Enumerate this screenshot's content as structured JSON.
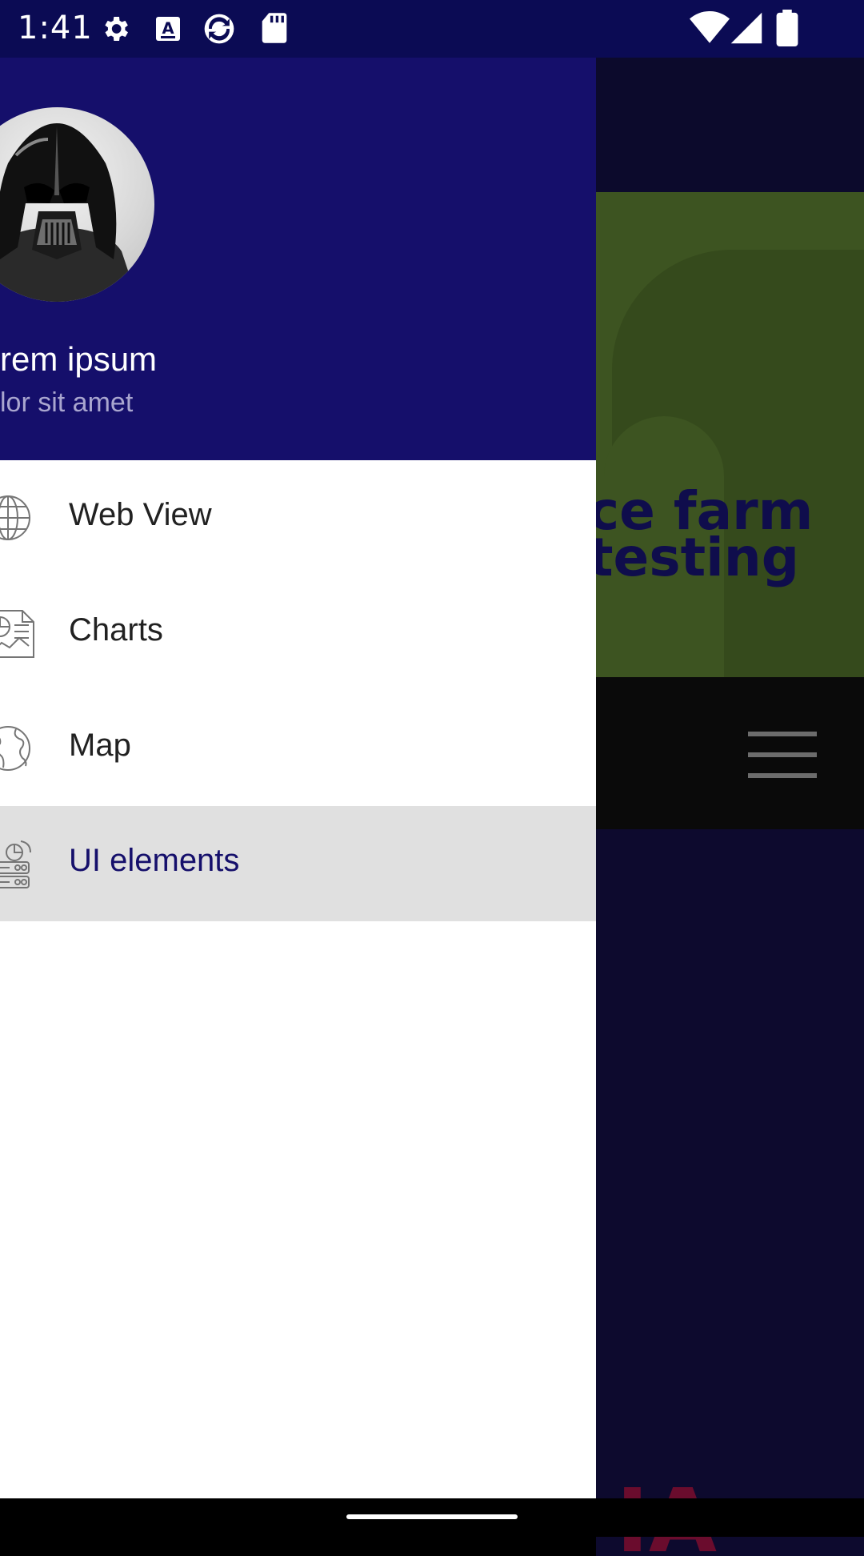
{
  "status_bar": {
    "time": "1:41",
    "icons_left": [
      "settings-icon",
      "a-badge-icon",
      "sync-app-icon",
      "sd-card-icon"
    ],
    "icons_right": [
      "wifi-icon",
      "signal-icon",
      "battery-icon"
    ]
  },
  "drawer": {
    "user_name": "rem ipsum",
    "user_subtitle": "lor sit amet",
    "items": [
      {
        "label": "Web View",
        "icon": "globe-icon",
        "active": false
      },
      {
        "label": "Charts",
        "icon": "chart-document-icon",
        "active": false
      },
      {
        "label": "Map",
        "icon": "earth-icon",
        "active": false
      },
      {
        "label": "UI elements",
        "icon": "ui-elements-icon",
        "active": true
      }
    ]
  },
  "background": {
    "hero_line1": "ce farm",
    "hero_line2": "testing"
  },
  "colors": {
    "header": "#150f6b",
    "active_item_bg": "#e0e0e0",
    "active_item_text": "#150f6b",
    "status_bar": "#0b0b54"
  }
}
